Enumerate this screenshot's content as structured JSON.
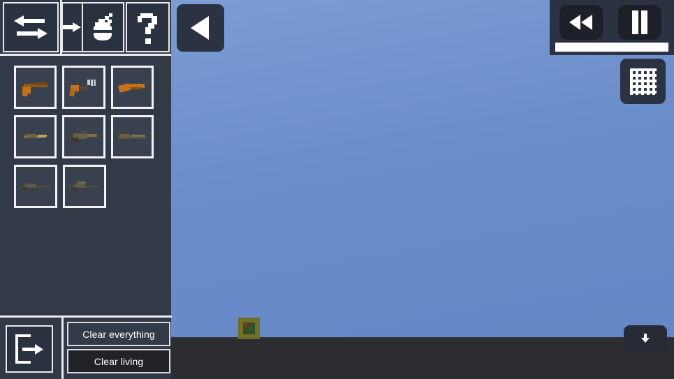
{
  "world": {
    "sky_color_top": "#7f9ed4",
    "sky_color_bottom": "#6486c6",
    "ground_color": "#2c2d30",
    "entity_label": "green-block-entity"
  },
  "sidebar": {
    "toolbar": [
      {
        "name": "swap-arrows-icon",
        "label": "Swap"
      },
      {
        "name": "arrow-right-icon",
        "label": "Next"
      },
      {
        "name": "grenade-icon",
        "label": "Explosives"
      },
      {
        "name": "question-mark-icon",
        "label": "Help"
      }
    ],
    "items": [
      {
        "name": "item-pistol",
        "label": "Pistol"
      },
      {
        "name": "item-smg",
        "label": "SMG"
      },
      {
        "name": "item-sawn-off",
        "label": "Sawn-off"
      },
      {
        "name": "item-carbine",
        "label": "Carbine"
      },
      {
        "name": "item-rifle",
        "label": "Rifle"
      },
      {
        "name": "item-assault-rifle",
        "label": "Assault Rifle"
      },
      {
        "name": "item-shotgun",
        "label": "Shotgun"
      },
      {
        "name": "item-sniper",
        "label": "Sniper"
      }
    ],
    "exit_button": {
      "name": "exit-icon",
      "label": "Exit"
    },
    "clear_panel": {
      "clear_everything_label": "Clear everything",
      "clear_living_label": "Clear living"
    }
  },
  "collapse": {
    "label": "Collapse panel",
    "icon": "triangle-left-icon"
  },
  "playback": {
    "rewind_label": "Rewind",
    "pause_label": "Pause",
    "speed_percent": 100
  },
  "grid_button": {
    "label": "Toggle grid",
    "icon": "grid-icon"
  },
  "download_button": {
    "label": "Download",
    "icon": "download-icon"
  },
  "colors": {
    "panel": "#323a47",
    "panel_dark": "#2b3241",
    "border": "#e8eaee",
    "accent_white": "#ffffff"
  }
}
